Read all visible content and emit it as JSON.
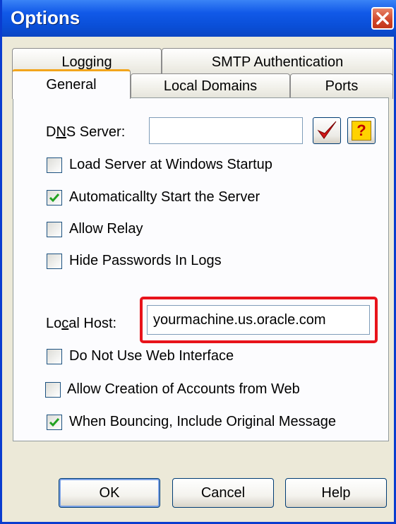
{
  "window": {
    "title": "Options"
  },
  "tabs": {
    "row1": [
      "Logging",
      "SMTP Authentication"
    ],
    "row2": [
      "General",
      "Local Domains",
      "Ports"
    ],
    "active": "General"
  },
  "general": {
    "dns_server": {
      "label_pre": "D",
      "label_u": "N",
      "label_post": "S Server:",
      "value": ""
    },
    "check_icon": "checkmark-icon",
    "help_icon": "question-icon",
    "options": [
      {
        "label": "Load Server at Windows Startup",
        "checked": false
      },
      {
        "label": "Automaticallty Start the Server",
        "checked": true
      },
      {
        "label": "Allow Relay",
        "checked": false
      },
      {
        "label": "Hide Passwords In Logs",
        "checked": false
      }
    ],
    "local_host": {
      "label_pre": "Lo",
      "label_u": "c",
      "label_post": "al Host:",
      "value": "yourmachine.us.oracle.com"
    },
    "options2": [
      {
        "label": "Do Not Use Web Interface",
        "checked": false
      },
      {
        "label": "Allow Creation of Accounts from Web",
        "checked": false
      },
      {
        "label": "When Bouncing, Include Original Message",
        "checked": true
      }
    ]
  },
  "buttons": {
    "ok": "OK",
    "cancel": "Cancel",
    "help": "Help"
  },
  "colors": {
    "titlebar": "#0a4fd8",
    "highlight": "#e8131b",
    "check": "#21a121"
  }
}
